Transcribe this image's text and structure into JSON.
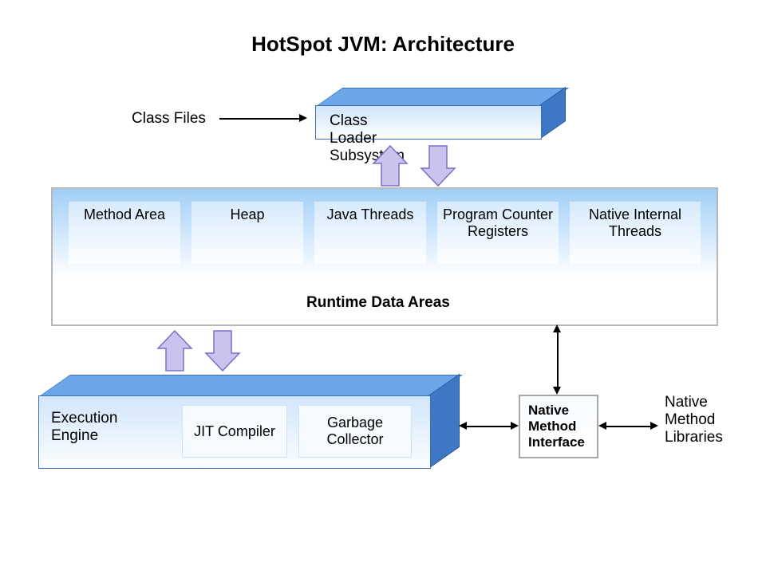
{
  "title": "HotSpot JVM: Architecture",
  "classFilesLabel": "Class Files",
  "classLoaderLabel": "Class Loader Subsystem",
  "runtime": {
    "label": "Runtime Data Areas",
    "areas": [
      "Method Area",
      "Heap",
      "Java Threads",
      "Program Counter Registers",
      "Native Internal Threads"
    ]
  },
  "execution": {
    "label": "Execution Engine",
    "jit": "JIT Compiler",
    "gc": "Garbage Collector"
  },
  "nmi": "Native Method Interface",
  "nml": "Native Method Libraries"
}
